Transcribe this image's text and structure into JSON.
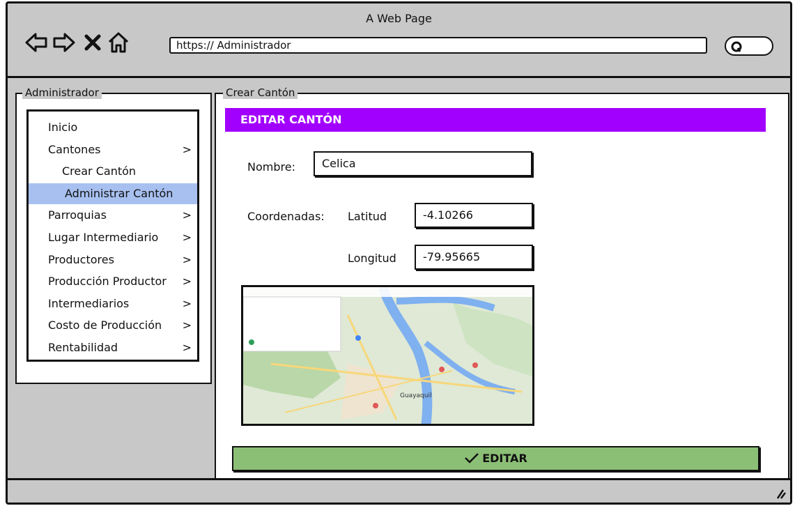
{
  "window": {
    "title": "A Web Page"
  },
  "toolbar": {
    "back_icon": "back-arrow-icon",
    "forward_icon": "forward-arrow-icon",
    "stop_icon": "close-icon",
    "home_icon": "home-icon",
    "url": "https:// Administrador",
    "search_icon": "search-icon"
  },
  "sidebar": {
    "legend": "Administrador",
    "items": [
      {
        "label": "Inicio",
        "has_chevron": false
      },
      {
        "label": "Cantones",
        "has_chevron": true
      },
      {
        "label": "Crear Cantón",
        "has_chevron": false,
        "sub": true
      },
      {
        "label": "Administrar Cantón",
        "has_chevron": false,
        "sub": true,
        "active": true
      },
      {
        "label": "Parroquias",
        "has_chevron": true
      },
      {
        "label": "Lugar Intermediario",
        "has_chevron": true
      },
      {
        "label": "Productores",
        "has_chevron": true
      },
      {
        "label": "Producción Productor",
        "has_chevron": true
      },
      {
        "label": "Intermediarios",
        "has_chevron": true
      },
      {
        "label": "Costo de Producción",
        "has_chevron": true
      },
      {
        "label": "Rentabilidad",
        "has_chevron": true
      }
    ],
    "chevron": ">"
  },
  "main": {
    "legend": "Crear Cantón",
    "header": "EDITAR CANTÓN",
    "nombre_label": "Nombre:",
    "nombre_value": "Celica",
    "coordenadas_label": "Coordenadas:",
    "latitud_label": "Latitud",
    "latitud_value": "-4.10266",
    "longitud_label": "Longitud",
    "longitud_value": "-79.95665",
    "map_city": "Guayaquil",
    "submit_label": "EDITAR"
  },
  "colors": {
    "header_bg": "#a100ff",
    "active_item": "#a7c0f0",
    "button_bg": "#8cbf76",
    "chrome_bg": "#c8c8c8"
  }
}
